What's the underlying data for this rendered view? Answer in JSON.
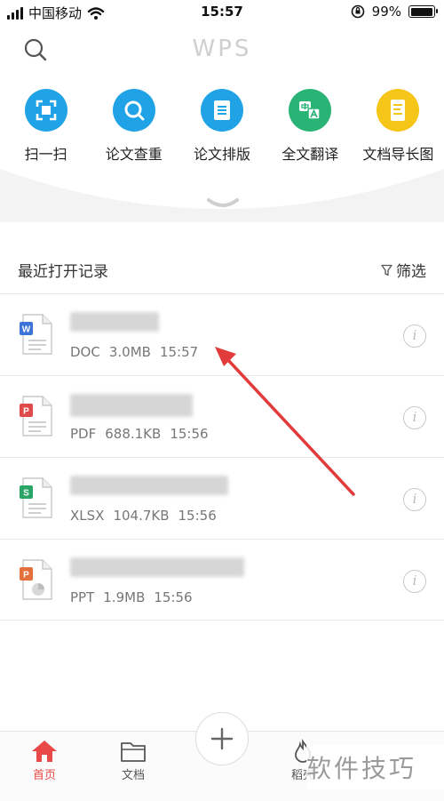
{
  "status_bar": {
    "carrier": "中国移动",
    "time": "15:57",
    "battery": "99%",
    "battery_level": 0.99
  },
  "header": {
    "logo": "WPS"
  },
  "tools": [
    {
      "label": "扫一扫",
      "icon": "scan-icon",
      "color": "#1fa3e6"
    },
    {
      "label": "论文查重",
      "icon": "paper-check-icon",
      "color": "#1fa3e6"
    },
    {
      "label": "论文排版",
      "icon": "paper-layout-icon",
      "color": "#1fa3e6"
    },
    {
      "label": "全文翻译",
      "icon": "translate-icon",
      "color": "#29b475"
    },
    {
      "label": "文档导长图",
      "icon": "long-image-icon",
      "color": "#f5c518"
    }
  ],
  "recent": {
    "title": "最近打开记录",
    "filter_label": "筛选"
  },
  "files": [
    {
      "type": "DOC",
      "size": "3.0MB",
      "time": "15:57",
      "color": "#3b73d9",
      "letter": "W"
    },
    {
      "type": "PDF",
      "size": "688.1KB",
      "time": "15:56",
      "color": "#e04a4a",
      "letter": "P"
    },
    {
      "type": "XLSX",
      "size": "104.7KB",
      "time": "15:56",
      "color": "#2aa566",
      "letter": "S"
    },
    {
      "type": "PPT",
      "size": "1.9MB",
      "time": "15:56",
      "color": "#e5703b",
      "letter": "P"
    }
  ],
  "bottom_nav": {
    "home": "首页",
    "docs": "文档",
    "shell": "稻壳"
  },
  "watermark": "软件技巧",
  "colors": {
    "accent_red": "#e94949",
    "arrow": "#e23b3b"
  }
}
